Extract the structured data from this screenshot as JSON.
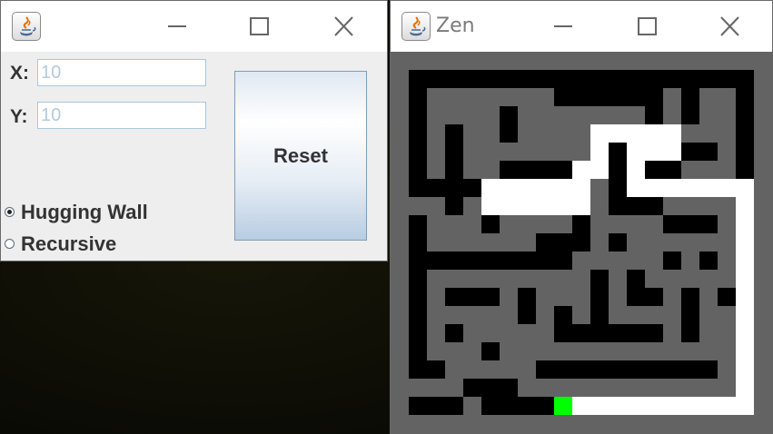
{
  "control_window": {
    "x_label": "X:",
    "x_value": "10",
    "y_label": "Y:",
    "y_value": "10",
    "reset_label": "Reset",
    "radio_options": [
      {
        "label": "Hugging Wall",
        "selected": true
      },
      {
        "label": "Recursive",
        "selected": false
      }
    ]
  },
  "maze_window": {
    "title": "Zen",
    "colors": {
      "wall": "#636363",
      "floor": "#000000",
      "solution_path": "#ffffff",
      "current_cell": "#00ff00"
    }
  },
  "icons": [
    "java-icon",
    "minimize-icon",
    "maximize-icon",
    "close-icon"
  ]
}
